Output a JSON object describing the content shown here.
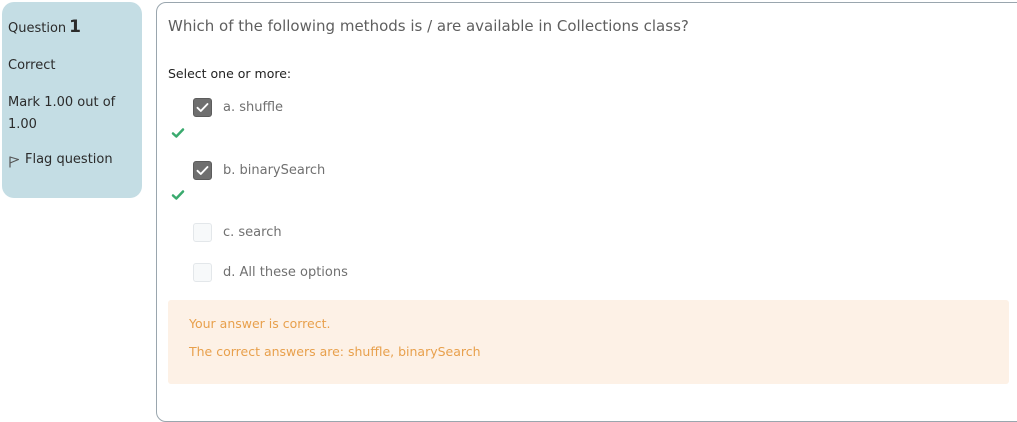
{
  "info": {
    "question_label": "Question",
    "question_number": "1",
    "state": "Correct",
    "grade": "Mark 1.00 out of 1.00",
    "flag_label": "Flag question",
    "flag_icon": "flag-icon"
  },
  "question": {
    "text": "Which of the following methods is / are available in Collections class?",
    "prompt": "Select one or more:",
    "options": [
      {
        "label": "a. shuffle",
        "checked": true,
        "correct_mark": true
      },
      {
        "label": "b. binarySearch",
        "checked": true,
        "correct_mark": true
      },
      {
        "label": "c. search",
        "checked": false,
        "correct_mark": false
      },
      {
        "label": "d. All these options",
        "checked": false,
        "correct_mark": false
      }
    ]
  },
  "feedback": {
    "general": "Your answer is correct.",
    "right_answer": "The correct answers are: shuffle, binarySearch"
  },
  "colors": {
    "info_bg": "#c4dde4",
    "tick_green": "#3aaa6e",
    "feedback_bg": "#fdf1e6",
    "feedback_text": "#e8a04c"
  }
}
